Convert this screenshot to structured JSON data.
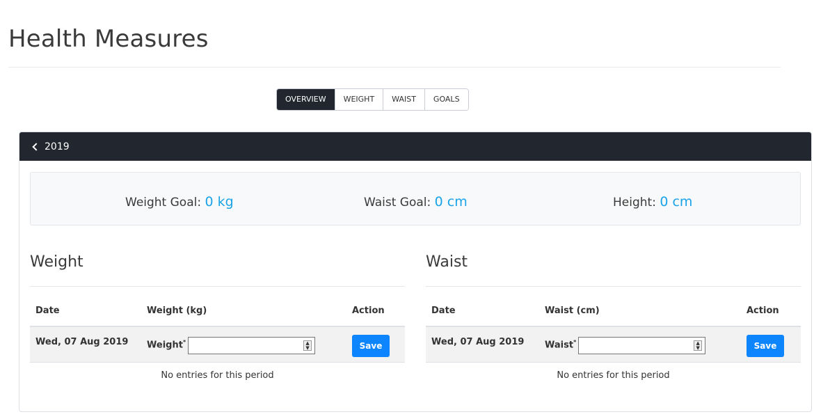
{
  "page": {
    "title": "Health Measures"
  },
  "tabs": [
    {
      "label": "OVERVIEW",
      "active": true
    },
    {
      "label": "WEIGHT",
      "active": false
    },
    {
      "label": "WAIST",
      "active": false
    },
    {
      "label": "GOALS",
      "active": false
    }
  ],
  "card": {
    "year": "2019",
    "goals": {
      "weight_label": "Weight Goal:",
      "weight_value": "0 kg",
      "waist_label": "Waist Goal:",
      "waist_value": "0 cm",
      "height_label": "Height:",
      "height_value": "0 cm"
    }
  },
  "weight": {
    "title": "Weight",
    "headers": {
      "date": "Date",
      "value": "Weight (kg)",
      "action": "Action"
    },
    "row": {
      "date": "Wed, 07 Aug 2019",
      "field_label": "Weight",
      "field_value": "",
      "save_label": "Save"
    },
    "empty_text": "No entries for this period"
  },
  "waist": {
    "title": "Waist",
    "headers": {
      "date": "Date",
      "value": "Waist (cm)",
      "action": "Action"
    },
    "row": {
      "date": "Wed, 07 Aug 2019",
      "field_label": "Waist",
      "field_value": "",
      "save_label": "Save"
    },
    "empty_text": "No entries for this period"
  },
  "colors": {
    "accent": "#1aa3e8",
    "dark": "#22262e",
    "primary_button": "#0d85ff"
  }
}
